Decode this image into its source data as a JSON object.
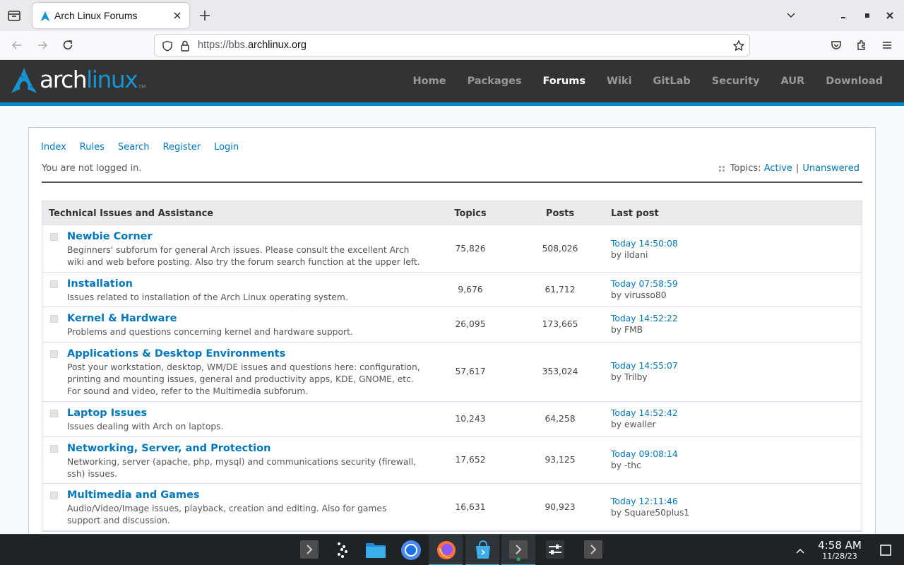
{
  "browser": {
    "tab_title": "Arch Linux Forums",
    "url_prefix": "https://bbs.",
    "url_domain": "archlinux.org"
  },
  "site": {
    "logo_main": "arch",
    "logo_accent": "linux",
    "logo_tm": "TM",
    "nav": [
      "Home",
      "Packages",
      "Forums",
      "Wiki",
      "GitLab",
      "Security",
      "AUR",
      "Download"
    ],
    "nav_current": "Forums",
    "brand_color": "#1793d1"
  },
  "forum": {
    "menu": [
      "Index",
      "Rules",
      "Search",
      "Register",
      "Login"
    ],
    "welcome": "You are not logged in.",
    "topics_label": "Topics:",
    "topics_active": "Active",
    "topics_sep": "|",
    "topics_unanswered": "Unanswered",
    "table": {
      "headers": {
        "category": "Technical Issues and Assistance",
        "topics": "Topics",
        "posts": "Posts",
        "last_post": "Last post"
      },
      "rows": [
        {
          "name": "Newbie Corner",
          "desc": "Beginners' subforum for general Arch issues. Please consult the excellent Arch wiki and web before posting. Also try the forum search function at the upper left.",
          "topics": "75,826",
          "posts": "508,026",
          "last_time": "Today 14:50:08",
          "last_by": "by ildani"
        },
        {
          "name": "Installation",
          "desc": "Issues related to installation of the Arch Linux operating system.",
          "topics": "9,676",
          "posts": "61,712",
          "last_time": "Today 07:58:59",
          "last_by": "by virusso80"
        },
        {
          "name": "Kernel & Hardware",
          "desc": "Problems and questions concerning kernel and hardware support.",
          "topics": "26,095",
          "posts": "173,665",
          "last_time": "Today 14:52:22",
          "last_by": "by FMB"
        },
        {
          "name": "Applications & Desktop Environments",
          "desc": "Post your workstation, desktop, WM/DE issues and questions here: configuration, printing and mounting issues, general and productivity apps, KDE, GNOME, etc. For sound and video, refer to the Multimedia subforum.",
          "topics": "57,617",
          "posts": "353,024",
          "last_time": "Today 14:55:07",
          "last_by": "by Trilby"
        },
        {
          "name": "Laptop Issues",
          "desc": "Issues dealing with Arch on laptops.",
          "topics": "10,243",
          "posts": "64,258",
          "last_time": "Today 14:52:42",
          "last_by": "by ewaller"
        },
        {
          "name": "Networking, Server, and Protection",
          "desc": "Networking, server (apache, php, mysql) and communications security (firewall, ssh) issues.",
          "topics": "17,652",
          "posts": "93,125",
          "last_time": "Today 09:08:14",
          "last_by": "by -thc"
        },
        {
          "name": "Multimedia and Games",
          "desc": "Audio/Video/Image issues, playback, creation and editing. Also for games support and discussion.",
          "topics": "16,631",
          "posts": "90,923",
          "last_time": "Today 12:11:46",
          "last_by": "by Square50plus1"
        }
      ]
    }
  },
  "taskbar": {
    "apps": [
      "terminal-icon",
      "app-launcher-icon",
      "file-manager-icon",
      "chromium-icon",
      "firefox-icon",
      "software-store-icon",
      "terminal-icon",
      "system-settings-icon",
      "terminal-icon"
    ],
    "time": "4:58 AM",
    "date": "11/28/23"
  }
}
